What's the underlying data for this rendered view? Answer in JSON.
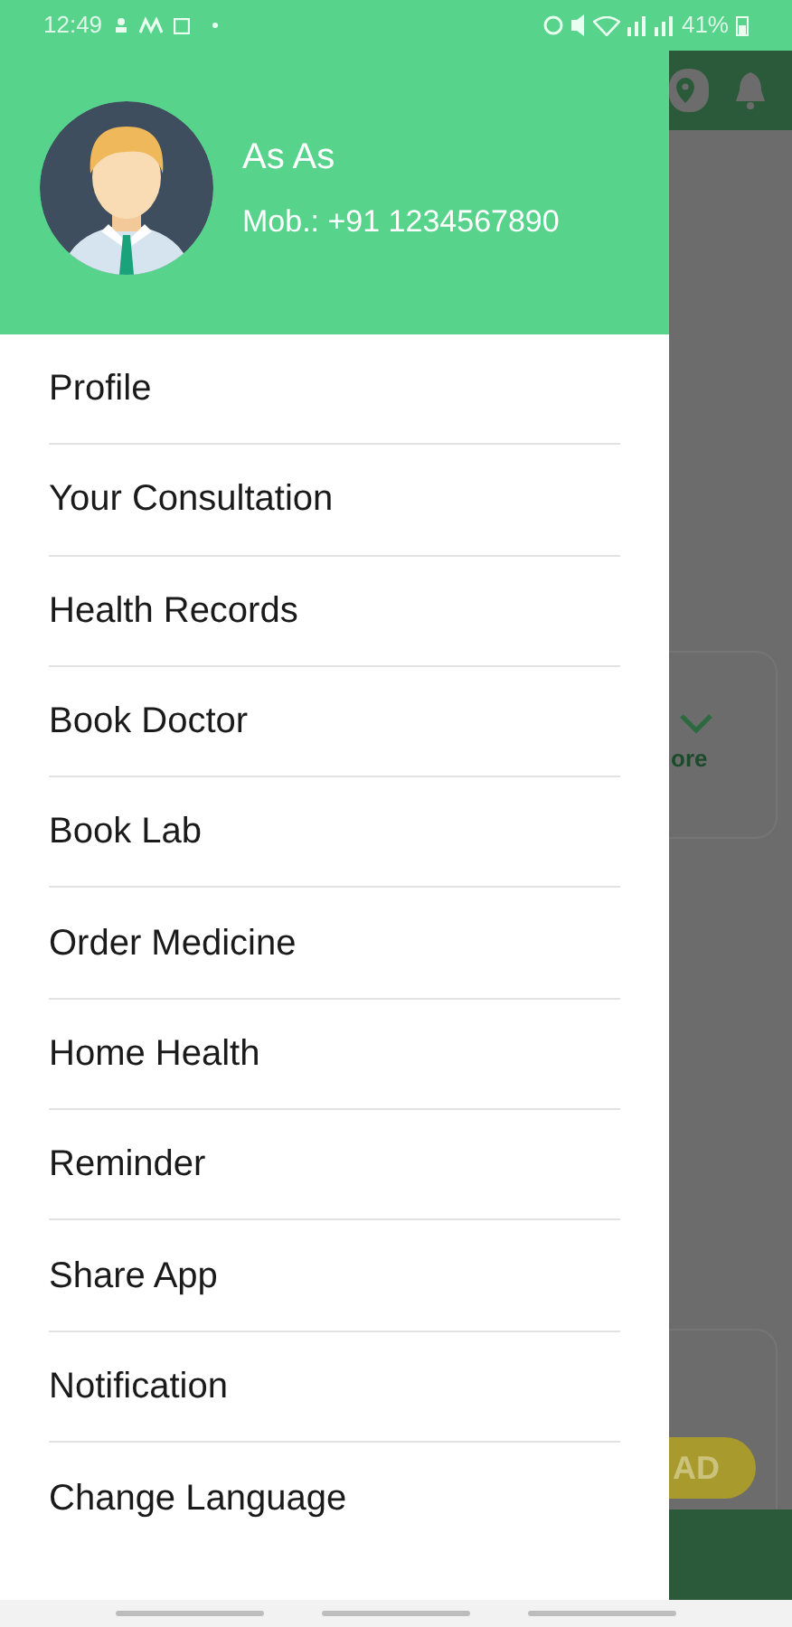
{
  "status_bar": {
    "time": "12:49",
    "battery": "41%"
  },
  "profile": {
    "name": "As As",
    "mobile": "Mob.: +91 1234567890"
  },
  "menu": [
    {
      "label": "Profile"
    },
    {
      "label": "Your Consultation"
    },
    {
      "label": "Health Records"
    },
    {
      "label": "Book Doctor"
    },
    {
      "label": "Book Lab"
    },
    {
      "label": "Order Medicine"
    },
    {
      "label": "Home Health"
    },
    {
      "label": "Reminder"
    },
    {
      "label": "Share App"
    },
    {
      "label": "Notification"
    },
    {
      "label": "Change Language"
    }
  ],
  "background": {
    "more_label": "ore",
    "ad_button": "AD"
  }
}
